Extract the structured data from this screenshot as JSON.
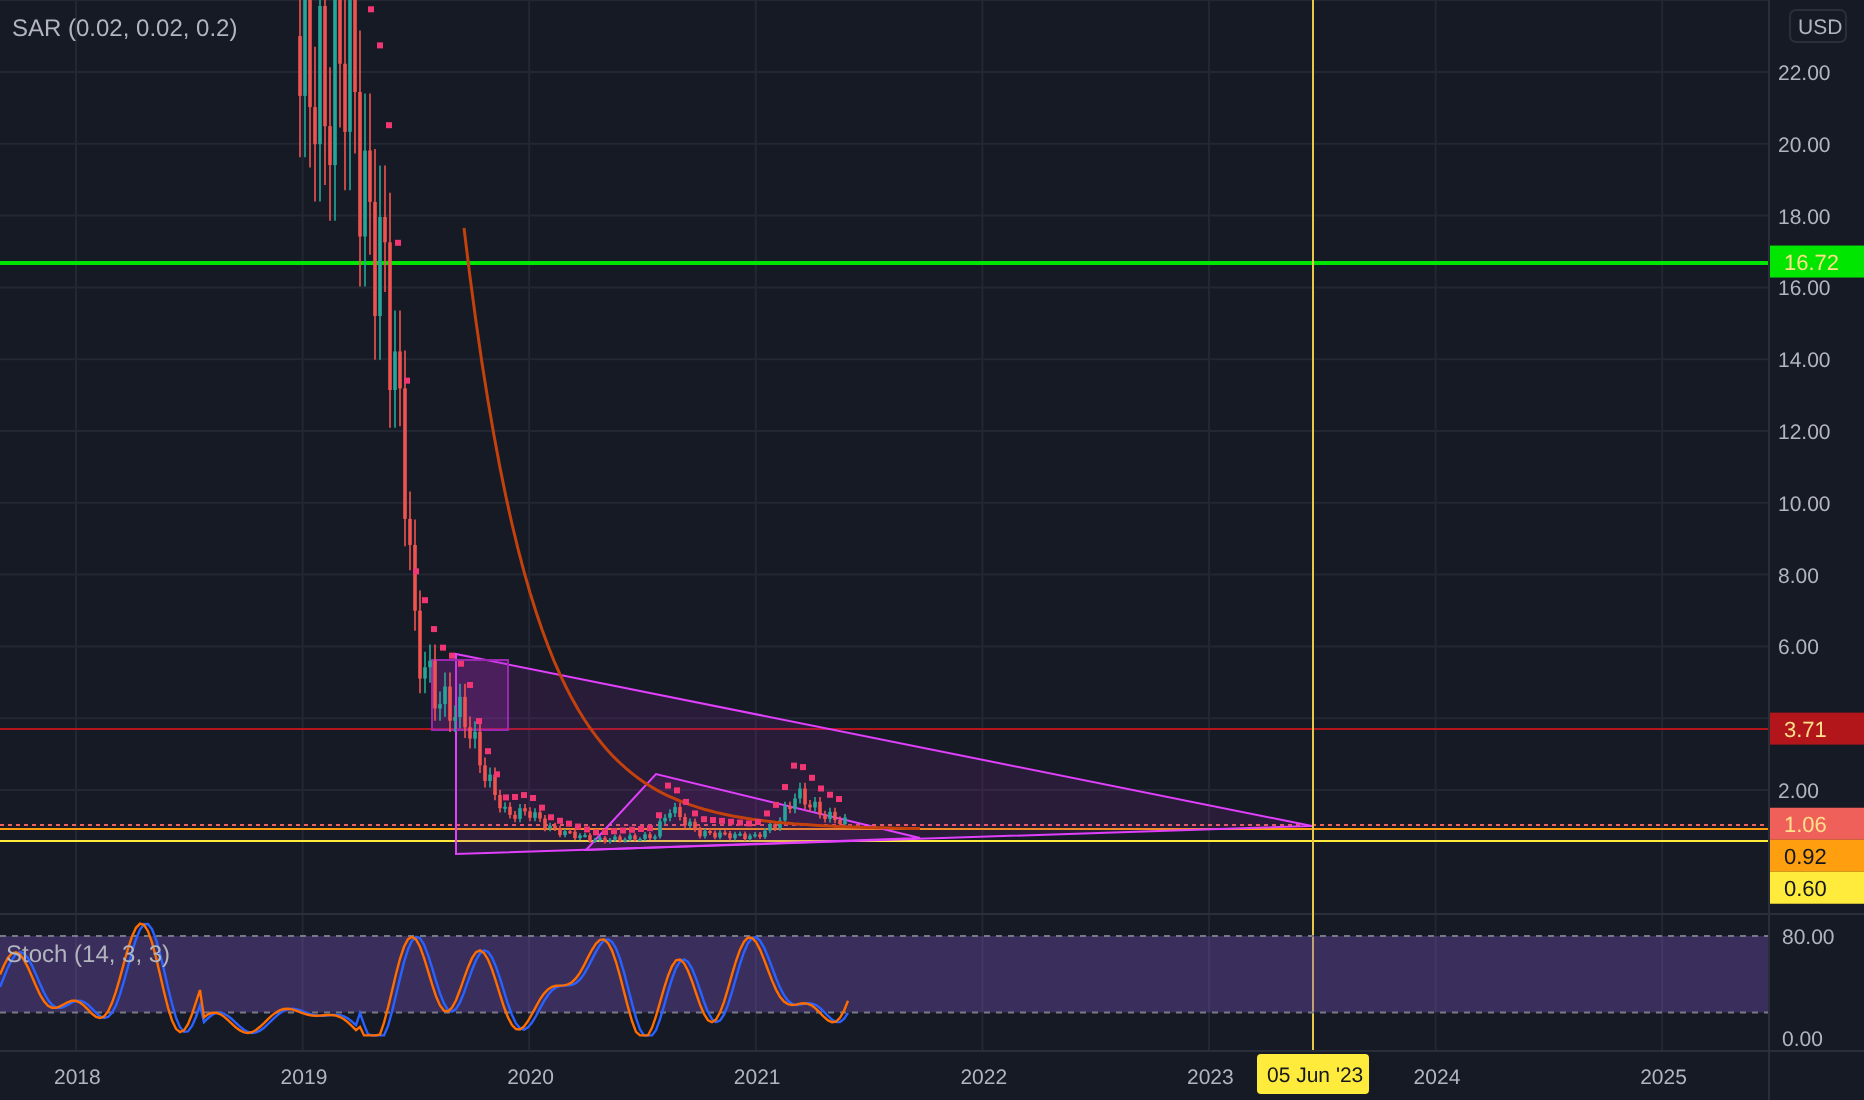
{
  "indicators": [
    {
      "label": "SAR (0.02, 0.02, 0.2)"
    },
    {
      "label": "Stoch (14, 3, 3)"
    }
  ],
  "price_axis": {
    "currency": "USD",
    "ticks": [
      "22.00",
      "20.00",
      "18.00",
      "16.00",
      "14.00",
      "12.00",
      "10.00",
      "8.00",
      "6.00",
      "2.00"
    ]
  },
  "price_labels": [
    {
      "text": "16.72",
      "color": "#00e600"
    },
    {
      "text": "3.71",
      "color": "#b2161b"
    },
    {
      "text": "1.06",
      "color": "#f0605a"
    },
    {
      "text": "0.92",
      "color": "#ff9f10"
    },
    {
      "text": "0.60",
      "color": "#ffeb3b"
    }
  ],
  "stoch_axis": {
    "ticks": [
      "80.00",
      "0.00"
    ]
  },
  "time_axis": {
    "ticks": [
      "2018",
      "2019",
      "2020",
      "2021",
      "2022",
      "2023",
      "2024",
      "2025"
    ]
  },
  "crosshair": {
    "label": "05 Jun '23"
  }
}
